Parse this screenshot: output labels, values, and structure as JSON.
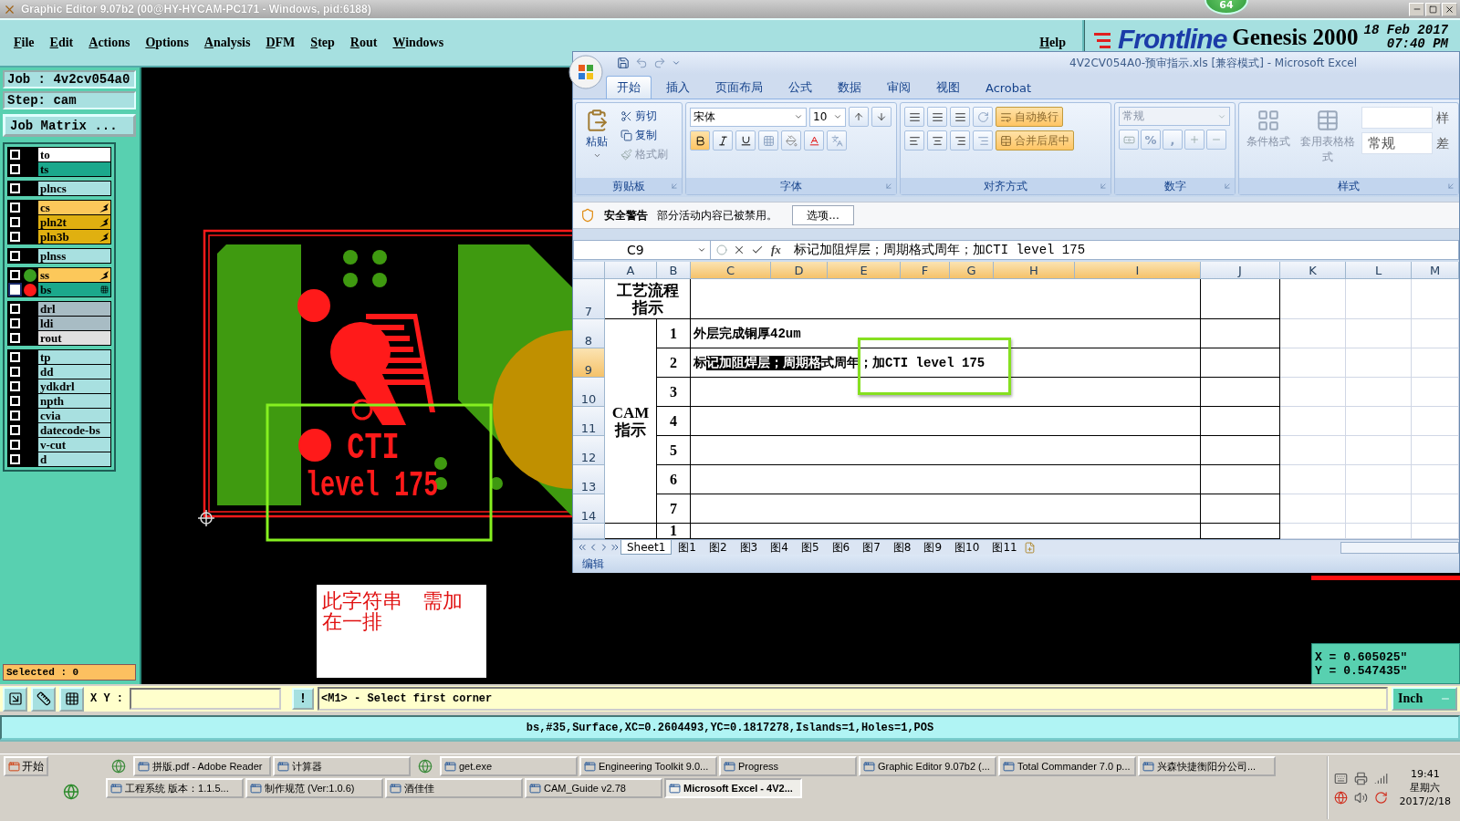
{
  "title_bar": {
    "title": "Graphic Editor 9.07b2 (00@HY-HYCAM-PC171 - Windows, pid:6188)",
    "badge": "64"
  },
  "menu": [
    {
      "label": "File"
    },
    {
      "label": "Edit"
    },
    {
      "label": "Actions"
    },
    {
      "label": "Options"
    },
    {
      "label": "Analysis"
    },
    {
      "label": "DFM"
    },
    {
      "label": "Step"
    },
    {
      "label": "Rout"
    },
    {
      "label": "Windows"
    }
  ],
  "help": "Help",
  "brand": {
    "logo": "Frontline",
    "product": "Genesis 2000",
    "date": "18 Feb 2017",
    "time": "07:40 PM"
  },
  "job_panel": {
    "job": "Job : 4v2cv054a0",
    "step": "Step: cam",
    "matrix_button": "Job Matrix ...",
    "selected_count": "Selected : 0",
    "layer_groups": [
      {
        "layers": [
          {
            "name": "to",
            "color": "#ffffff",
            "affected": false,
            "selected": false
          },
          {
            "name": "ts",
            "color": "#1ba88c",
            "affected": false,
            "selected": false
          }
        ]
      },
      {
        "layers": [
          {
            "name": "plncs",
            "color": "#a8e0e0",
            "affected": false,
            "selected": false
          }
        ]
      },
      {
        "layers": [
          {
            "name": "cs",
            "color": "#fcc85a",
            "affected": true,
            "selected": false
          },
          {
            "name": "pln2t",
            "color": "#e0b010",
            "affected": true,
            "selected": false
          },
          {
            "name": "pln3b",
            "color": "#e0b010",
            "affected": true,
            "selected": false
          }
        ]
      },
      {
        "layers": [
          {
            "name": "plnss",
            "color": "#a8e0e0",
            "affected": false,
            "selected": false
          }
        ]
      },
      {
        "layers": [
          {
            "name": "ss",
            "color": "#fcc85a",
            "dot": {
              "color": "#3aa020"
            },
            "affected": true,
            "selected": false
          },
          {
            "name": "bs",
            "color": "#1ba88c",
            "dot": {
              "color": "#ff1a1a"
            },
            "affected": false,
            "selected": true
          }
        ]
      },
      {
        "layers": [
          {
            "name": "drl",
            "color": "#a8bcc4",
            "affected": false,
            "selected": false
          },
          {
            "name": "ldi",
            "color": "#a8bcc4",
            "affected": false,
            "selected": false
          },
          {
            "name": "rout",
            "color": "#e0e0e0",
            "affected": false,
            "selected": false
          }
        ]
      },
      {
        "layers": [
          {
            "name": "tp",
            "color": "#a8e0e0",
            "affected": false,
            "selected": false
          },
          {
            "name": "dd",
            "color": "#a8e0e0",
            "affected": false,
            "selected": false
          },
          {
            "name": "ydkdrl",
            "color": "#a8e0e0",
            "affected": false,
            "selected": false
          },
          {
            "name": "npth",
            "color": "#a8e0e0",
            "affected": false,
            "selected": false
          },
          {
            "name": "cvia",
            "color": "#a8e0e0",
            "affected": false,
            "selected": false
          },
          {
            "name": "datecode-bs",
            "color": "#a8e0e0",
            "affected": false,
            "selected": false
          },
          {
            "name": "v-cut",
            "color": "#a8e0e0",
            "affected": false,
            "selected": false
          },
          {
            "name": "d",
            "color": "#a8e0e0",
            "affected": false,
            "selected": false
          }
        ]
      }
    ]
  },
  "canvas": {
    "board_text": [
      "CTI",
      "level 175"
    ],
    "note_lines": [
      "此字符串　需加",
      "在一排"
    ]
  },
  "readout": {
    "x": "X = 0.605025\"",
    "y": "Y = 0.547435\""
  },
  "excel": {
    "title": "4V2CV054A0-预审指示.xls  [兼容模式] - Microsoft Excel",
    "tabs": [
      {
        "label": "开始",
        "selected": true
      },
      {
        "label": "插入",
        "selected": false
      },
      {
        "label": "页面布局",
        "selected": false
      },
      {
        "label": "公式",
        "selected": false
      },
      {
        "label": "数据",
        "selected": false
      },
      {
        "label": "审阅",
        "selected": false
      },
      {
        "label": "视图",
        "selected": false
      },
      {
        "label": "Acrobat",
        "selected": false
      }
    ],
    "ribbon": {
      "clipboard": {
        "label": "剪贴板",
        "paste": "粘贴",
        "items": [
          {
            "label": "剪切",
            "disabled": false
          },
          {
            "label": "复制",
            "disabled": false
          },
          {
            "label": "格式刷",
            "disabled": true
          }
        ]
      },
      "font": {
        "label": "字体",
        "name": "宋体",
        "size": "10"
      },
      "alignment": {
        "label": "对齐方式",
        "buttons": [
          {
            "label": "自动换行",
            "on": true
          },
          {
            "label": "合并后居中",
            "on": true
          }
        ]
      },
      "number": {
        "label": "数字",
        "format": "常规",
        "symbols": [
          "%",
          ","
        ]
      },
      "styles": {
        "label": "样式",
        "commands": [
          {
            "label": "条件格式",
            "disabled": true
          },
          {
            "label": "套用表格格式",
            "disabled": true
          }
        ],
        "gallery": [
          "常规"
        ],
        "cut_labels": [
          "样",
          "差"
        ]
      }
    },
    "security": {
      "title": "安全警告",
      "message": "部分活动内容已被禁用。",
      "button": "选项..."
    },
    "name_box": "C9",
    "fx": "fx",
    "formula": "标记加阻焊层；周期格式周年；加CTI level 175",
    "columns": [
      {
        "label": "A",
        "selected": false
      },
      {
        "label": "B",
        "selected": false
      },
      {
        "label": "C",
        "selected": true
      },
      {
        "label": "D",
        "selected": true
      },
      {
        "label": "E",
        "selected": true
      },
      {
        "label": "F",
        "selected": true
      },
      {
        "label": "G",
        "selected": true
      },
      {
        "label": "H",
        "selected": true
      },
      {
        "label": "I",
        "selected": true
      },
      {
        "label": "J",
        "selected": false
      },
      {
        "label": "K",
        "selected": false
      },
      {
        "label": "L",
        "selected": false
      },
      {
        "label": "M",
        "selected": false
      }
    ],
    "rows": [
      {
        "label": "7",
        "selected": false
      },
      {
        "label": "8",
        "selected": false
      },
      {
        "label": "9",
        "selected": true
      },
      {
        "label": "10",
        "selected": false
      },
      {
        "label": "11",
        "selected": false
      },
      {
        "label": "12",
        "selected": false
      },
      {
        "label": "13",
        "selected": false
      },
      {
        "label": "14",
        "selected": false
      }
    ],
    "blocks": [
      {
        "title": "工艺流程指示"
      },
      {
        "title": "CAM指示",
        "items": [
          {
            "number": "1",
            "segments": [
              {
                "text": "外层完成铜厚42um",
                "selected": false
              }
            ]
          },
          {
            "number": "2",
            "segments": [
              {
                "text": "标",
                "selected": false
              },
              {
                "text": "记加阻焊层；周期格",
                "selected": true
              },
              {
                "text": "式周年；加CTI level 175",
                "selected": false
              }
            ]
          },
          {
            "number": "3"
          },
          {
            "number": "4"
          },
          {
            "number": "5"
          },
          {
            "number": "6"
          },
          {
            "number": "7"
          }
        ]
      },
      {
        "items": [
          {
            "number": "1"
          }
        ]
      }
    ],
    "sheet_tabs": [
      {
        "label": "Sheet1",
        "selected": true
      },
      {
        "label": "图1",
        "selected": false
      },
      {
        "label": "图2",
        "selected": false
      },
      {
        "label": "图3",
        "selected": false
      },
      {
        "label": "图4",
        "selected": false
      },
      {
        "label": "图5",
        "selected": false
      },
      {
        "label": "图6",
        "selected": false
      },
      {
        "label": "图7",
        "selected": false
      },
      {
        "label": "图8",
        "selected": false
      },
      {
        "label": "图9",
        "selected": false
      },
      {
        "label": "图10",
        "selected": false
      },
      {
        "label": "图11",
        "selected": false
      }
    ],
    "status": "编辑"
  },
  "command_bar": {
    "label": "X Y :",
    "alert": "!",
    "message": "<M1> - Select first corner",
    "units": "Inch"
  },
  "status_bar": "bs,#35,Surface,XC=0.2604493,YC=0.1817278,Islands=1,Holes=1,POS",
  "taskbar": {
    "start": "开始",
    "rows": [
      {
        "items": [
          {
            "kind": "launcher"
          },
          {
            "kind": "window",
            "label": "拼版.pdf - Adobe Reader",
            "selected": false
          },
          {
            "kind": "window",
            "label": "计算器",
            "selected": false
          },
          {
            "kind": "launcher"
          },
          {
            "kind": "window",
            "label": "get.exe",
            "selected": false
          },
          {
            "kind": "window",
            "label": "Engineering Toolkit 9.0...",
            "selected": false
          },
          {
            "kind": "window",
            "label": "Progress",
            "selected": false
          },
          {
            "kind": "window",
            "label": "Graphic Editor 9.07b2 (...",
            "selected": false
          },
          {
            "kind": "window",
            "label": "Total Commander 7.0 p...",
            "selected": false
          },
          {
            "kind": "window",
            "label": "兴森快捷衡阳分公司...",
            "selected": false
          }
        ]
      },
      {
        "items": [
          {
            "kind": "window",
            "label": "工程系统  版本：1.1.5...",
            "selected": false
          },
          {
            "kind": "window",
            "label": "制作规范 (Ver:1.0.6)",
            "selected": false
          },
          {
            "kind": "window",
            "label": "酒佳佳",
            "selected": false
          },
          {
            "kind": "window",
            "label": "CAM_Guide v2.78",
            "selected": false
          },
          {
            "kind": "window",
            "label": "Microsoft Excel - 4V2...",
            "selected": true
          }
        ]
      }
    ],
    "clock": {
      "time": "19:41",
      "weekday": "星期六",
      "date": "2017/2/18"
    }
  }
}
